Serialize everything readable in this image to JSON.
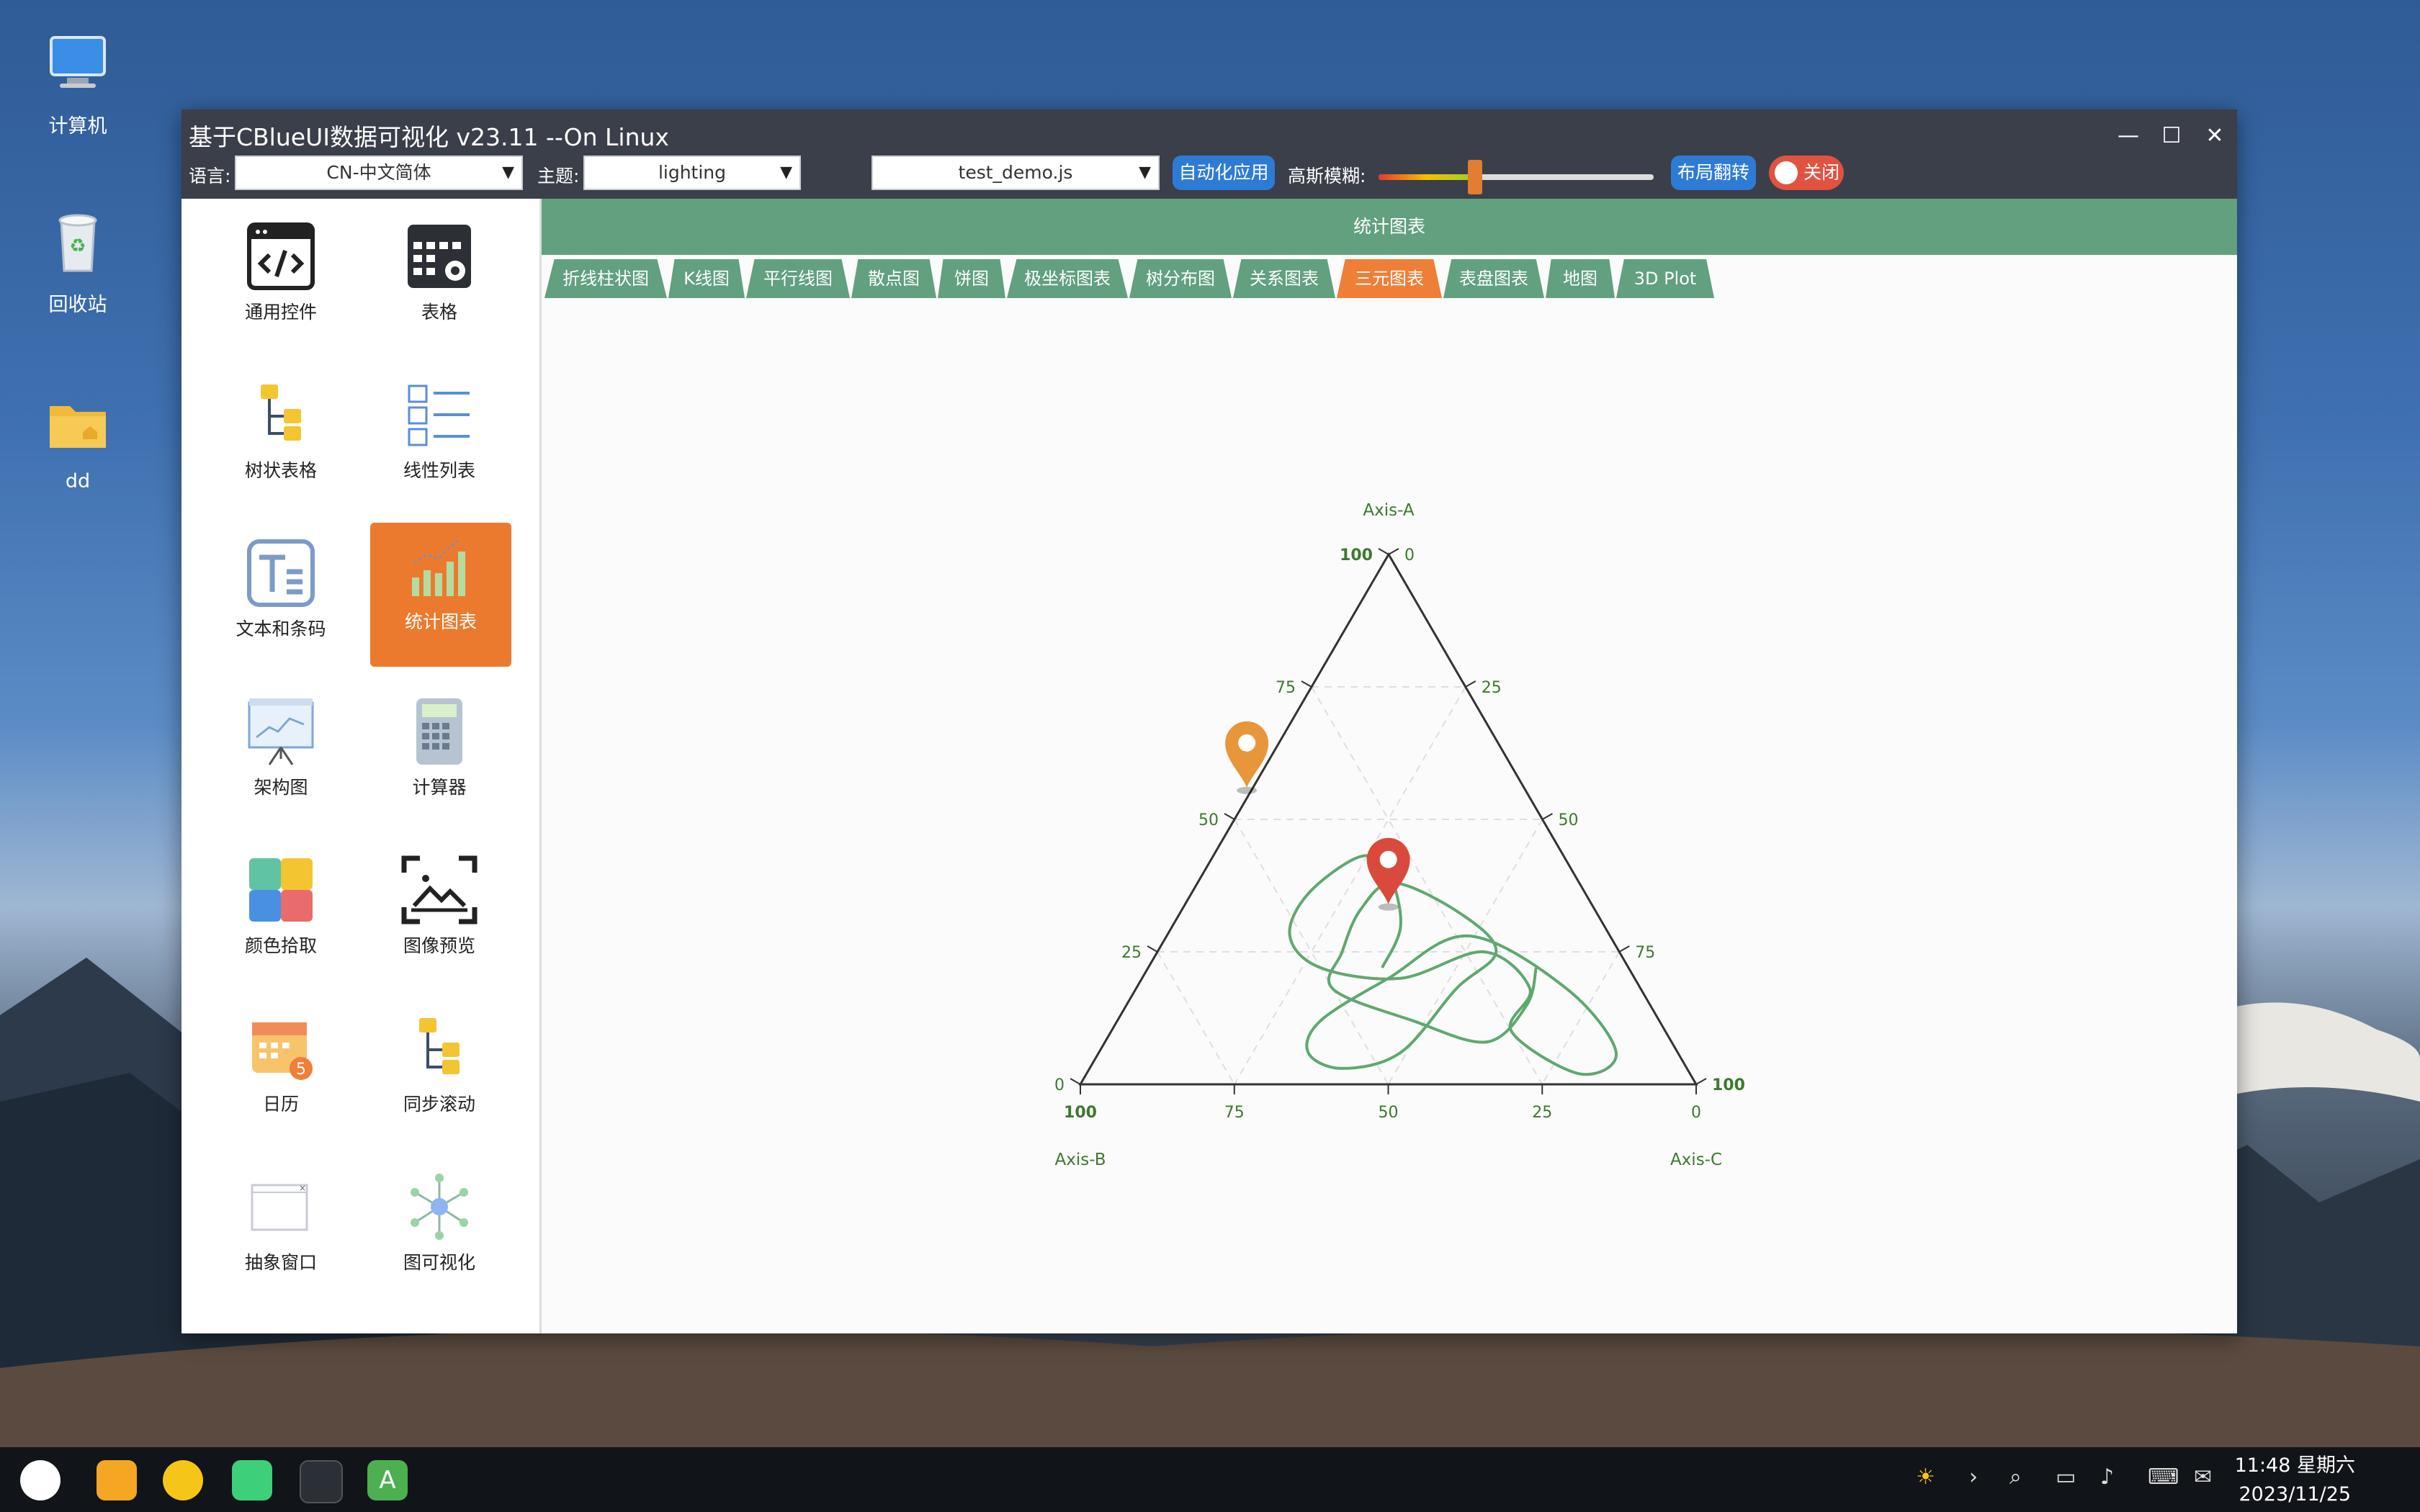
{
  "desktop": {
    "icons": [
      {
        "label": "计算机"
      },
      {
        "label": "回收站"
      },
      {
        "label": "dd"
      }
    ]
  },
  "window": {
    "title": "基于CBlueUI数据可视化 v23.11 --On Linux",
    "toolbar": {
      "language_label": "语言:",
      "language_value": "CN-中文简体",
      "theme_label": "主题:",
      "theme_value": "lighting",
      "script_value": "test_demo.js",
      "auto_apply_button": "自动化应用",
      "blur_label": "高斯模糊:",
      "blur_level": 0.35,
      "layout_flip_button": "布局翻转",
      "toggle_label": "关闭"
    }
  },
  "sidebar": {
    "items": [
      {
        "label": "通用控件"
      },
      {
        "label": "表格"
      },
      {
        "label": "树状表格"
      },
      {
        "label": "线性列表"
      },
      {
        "label": "文本和条码"
      },
      {
        "label": "统计图表",
        "active": true
      },
      {
        "label": "架构图"
      },
      {
        "label": "计算器"
      },
      {
        "label": "颜色拾取"
      },
      {
        "label": "图像预览"
      },
      {
        "label": "日历"
      },
      {
        "label": "同步滚动"
      },
      {
        "label": "抽象窗口"
      },
      {
        "label": "图可视化"
      }
    ]
  },
  "main": {
    "banner": "统计图表",
    "tabs": [
      {
        "label": "折线柱状图"
      },
      {
        "label": "K线图"
      },
      {
        "label": "平行线图"
      },
      {
        "label": "散点图"
      },
      {
        "label": "饼图"
      },
      {
        "label": "极坐标图表"
      },
      {
        "label": "树分布图"
      },
      {
        "label": "关系图表"
      },
      {
        "label": "三元图表",
        "active": true
      },
      {
        "label": "表盘图表"
      },
      {
        "label": "地图"
      },
      {
        "label": "3D Plot"
      }
    ]
  },
  "chart_data": {
    "type": "ternary",
    "axes": {
      "a": "Axis-A",
      "b": "Axis-B",
      "c": "Axis-C"
    },
    "ticks": [
      0,
      25,
      50,
      75,
      100
    ],
    "markers": [
      {
        "color": "#e8963a",
        "a": 56,
        "b": 45,
        "c": -1
      },
      {
        "color": "#d94a3c",
        "a": 34,
        "b": 33,
        "c": 33
      }
    ],
    "curve_color": "#5fa86f",
    "curve": [
      [
        22,
        40,
        38
      ],
      [
        30,
        33,
        37
      ],
      [
        40,
        30,
        30
      ],
      [
        43,
        33,
        24
      ],
      [
        36,
        45,
        19
      ],
      [
        28,
        52,
        20
      ],
      [
        22,
        50,
        28
      ],
      [
        20,
        38,
        42
      ],
      [
        25,
        22,
        53
      ],
      [
        18,
        18,
        64
      ],
      [
        10,
        25,
        65
      ],
      [
        2,
        18,
        80
      ],
      [
        6,
        10,
        84
      ],
      [
        18,
        12,
        70
      ],
      [
        28,
        23,
        49
      ],
      [
        20,
        40,
        40
      ],
      [
        12,
        55,
        33
      ],
      [
        6,
        60,
        34
      ],
      [
        3,
        56,
        41
      ],
      [
        6,
        45,
        49
      ],
      [
        18,
        30,
        52
      ],
      [
        25,
        20,
        55
      ],
      [
        32,
        22,
        46
      ],
      [
        38,
        30,
        32
      ],
      [
        33,
        38,
        29
      ],
      [
        25,
        45,
        30
      ],
      [
        18,
        50,
        32
      ],
      [
        12,
        40,
        48
      ],
      [
        8,
        30,
        62
      ],
      [
        15,
        20,
        65
      ],
      [
        22,
        15,
        63
      ]
    ]
  },
  "taskbar": {
    "time": "11:48 星期六",
    "date": "2023/11/25"
  }
}
